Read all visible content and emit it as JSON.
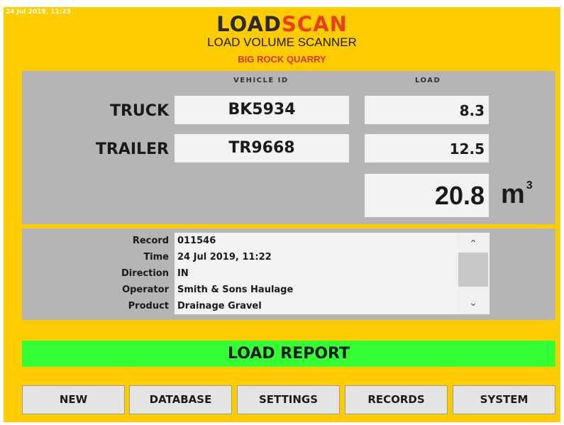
{
  "header": {
    "timestamp": "24 Jul 2019, 11:23",
    "logo_load": "LOAD",
    "logo_scan": "SCAN",
    "subtitle": "LOAD VOLUME SCANNER",
    "site": "BIG ROCK QUARRY"
  },
  "table": {
    "vehicle_id_header": "VEHICLE ID",
    "load_header": "LOAD",
    "rows": [
      {
        "label": "TRUCK",
        "vehicle_id": "BK5934",
        "load": "8.3"
      },
      {
        "label": "TRAILER",
        "vehicle_id": "TR9668",
        "load": "12.5"
      }
    ],
    "total": "20.8",
    "unit": "m",
    "unit_exp": "3"
  },
  "info": {
    "rows": [
      {
        "key": "Record",
        "value": "011546"
      },
      {
        "key": "Time",
        "value": "24 Jul 2019, 11:22"
      },
      {
        "key": "Direction",
        "value": "IN"
      },
      {
        "key": "Operator",
        "value": "Smith & Sons Haulage"
      },
      {
        "key": "Product",
        "value": "Drainage Gravel"
      }
    ],
    "scroll_up_icon": "chevron-up-icon",
    "scroll_down_icon": "chevron-down-icon"
  },
  "report": {
    "label": "LOAD REPORT",
    "color": "#33ff33"
  },
  "buttons": {
    "new": "NEW",
    "database": "DATABASE",
    "settings": "SETTINGS",
    "records": "RECORDS",
    "system": "SYSTEM"
  },
  "colors": {
    "background": "#ffcc00",
    "panel": "#b5b5b5",
    "scan_accent": "#e8401c",
    "site_text": "#d8322a"
  }
}
